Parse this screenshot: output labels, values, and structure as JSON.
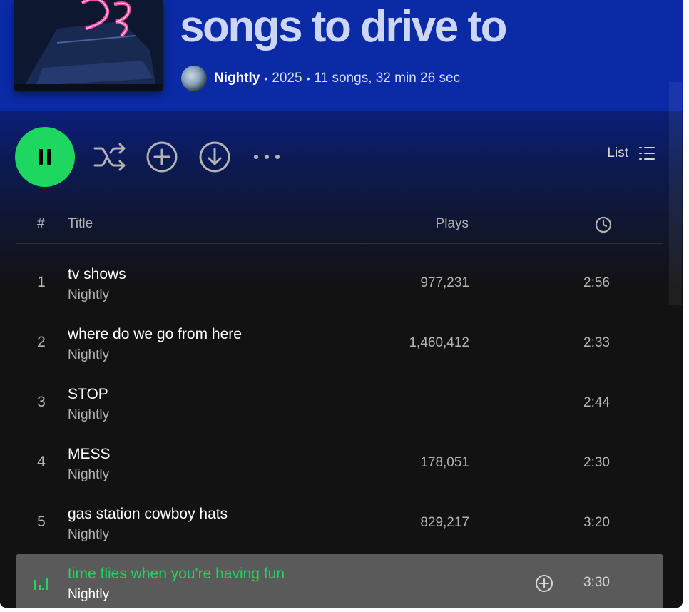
{
  "header": {
    "playlist_title": "songs to drive to",
    "owner": "Nightly",
    "year": "2025",
    "summary": "11 songs, 32 min 26 sec",
    "separator": "•",
    "bg_color": "#0b2aa6"
  },
  "controls": {
    "play_state": "playing",
    "play_icon": "pause-icon",
    "shuffle_icon": "shuffle-icon",
    "add_icon": "add-circle-icon",
    "download_icon": "download-icon",
    "more_icon": "more-options-icon",
    "view_label": "List",
    "view_icon": "list-view-icon",
    "accent_color": "#1ed760"
  },
  "table": {
    "headers": {
      "number": "#",
      "title": "Title",
      "plays": "Plays",
      "duration_icon": "clock-icon"
    },
    "rows": [
      {
        "number": "1",
        "title": "tv shows",
        "artist": "Nightly",
        "plays": "977,231",
        "duration": "2:56"
      },
      {
        "number": "2",
        "title": "where do we go from here",
        "artist": "Nightly",
        "plays": "1,460,412",
        "duration": "2:33"
      },
      {
        "number": "3",
        "title": "STOP",
        "artist": "Nightly",
        "plays": "",
        "duration": "2:44"
      },
      {
        "number": "4",
        "title": "MESS",
        "artist": "Nightly",
        "plays": "178,051",
        "duration": "2:30"
      },
      {
        "number": "5",
        "title": "gas station cowboy hats",
        "artist": "Nightly",
        "plays": "829,217",
        "duration": "3:20"
      },
      {
        "number": "",
        "title": "time flies when you're having fun",
        "artist": "Nightly",
        "plays": "",
        "duration": "3:30",
        "now_playing": true,
        "icon": "equalizer-icon",
        "row_action_icon": "add-circle-icon"
      }
    ]
  }
}
